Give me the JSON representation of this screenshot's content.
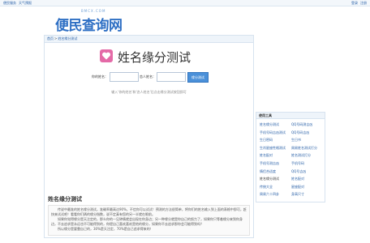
{
  "topbar": {
    "left": [
      "便民服务",
      "天气预报"
    ],
    "right": [
      "登录",
      "注册"
    ]
  },
  "logo": {
    "domain": "BMCX.COM",
    "brand": "便民查询网"
  },
  "breadcrumb": {
    "home": "首页",
    "sep": ">",
    "current": "姓名缘分测试"
  },
  "title": "姓名缘分测试",
  "form": {
    "label_you": "你的姓名：",
    "label_other": "恋人姓名：",
    "button": "缘分测试"
  },
  "tip": "输入'你的姓名'和'恋人姓名'后点击缘分测试按钮即可",
  "section": {
    "title": "姓名缘分测试",
    "paragraphs": [
      "传说中最准的姓名缘分测试，准确率最高达90%，不信你可以试试！预测的方法很简单，将你们的姓名输入到上面的表格中即可，赶快来试试吧！看看你们俩的缘分指数，说不定真有您的另一半就在眼前。",
      "如果你觉得缘分是天注定的，那么你的一见钟情就会出现在你身边；另一种缘分就是你自己的努力了，如果你只等着缘分来到你身边，不去追求是永远也不可能得到的，你提自己喜欢喜欢是他的缘分，如果你不去追求那你会可能得到吗？",
      "所以缘分是要靠自己的，30%是天注定，70%是自己追求得来的！"
    ]
  },
  "sidebar": {
    "title": "使用工具",
    "items": [
      {
        "label": "姓名缘分测试",
        "link": true
      },
      {
        "label": "QQ号码测吉凶",
        "link": true
      },
      {
        "label": "手机号码吉凶测试",
        "link": true
      },
      {
        "label": "QQ号码吉凶",
        "link": true
      },
      {
        "label": "生日密码",
        "link": true
      },
      {
        "label": "生日书",
        "link": true
      },
      {
        "label": "生肖星座性格测试",
        "link": true
      },
      {
        "label": "周易姓名测试打分",
        "link": true
      },
      {
        "label": "姓名配对",
        "link": true
      },
      {
        "label": "姓名测试打分",
        "link": true
      },
      {
        "label": "手机号测吉凶",
        "link": true
      },
      {
        "label": "手机号码",
        "link": true
      },
      {
        "label": "情侣合适度",
        "link": true
      },
      {
        "label": "QQ号吉凶",
        "link": true
      },
      {
        "label": "姓名缘分测试",
        "link": false
      },
      {
        "label": "姓名配对",
        "link": true
      },
      {
        "label": "传统大全",
        "link": true
      },
      {
        "label": "星座配对",
        "link": true
      },
      {
        "label": "周易六十四卦",
        "link": true
      },
      {
        "label": "身高尺寸",
        "link": true
      }
    ]
  },
  "colors": {
    "accent": "#2e6fc4",
    "link": "#2a61a8",
    "button": "#4a90d9",
    "icon_bg": "#e46aa7"
  }
}
